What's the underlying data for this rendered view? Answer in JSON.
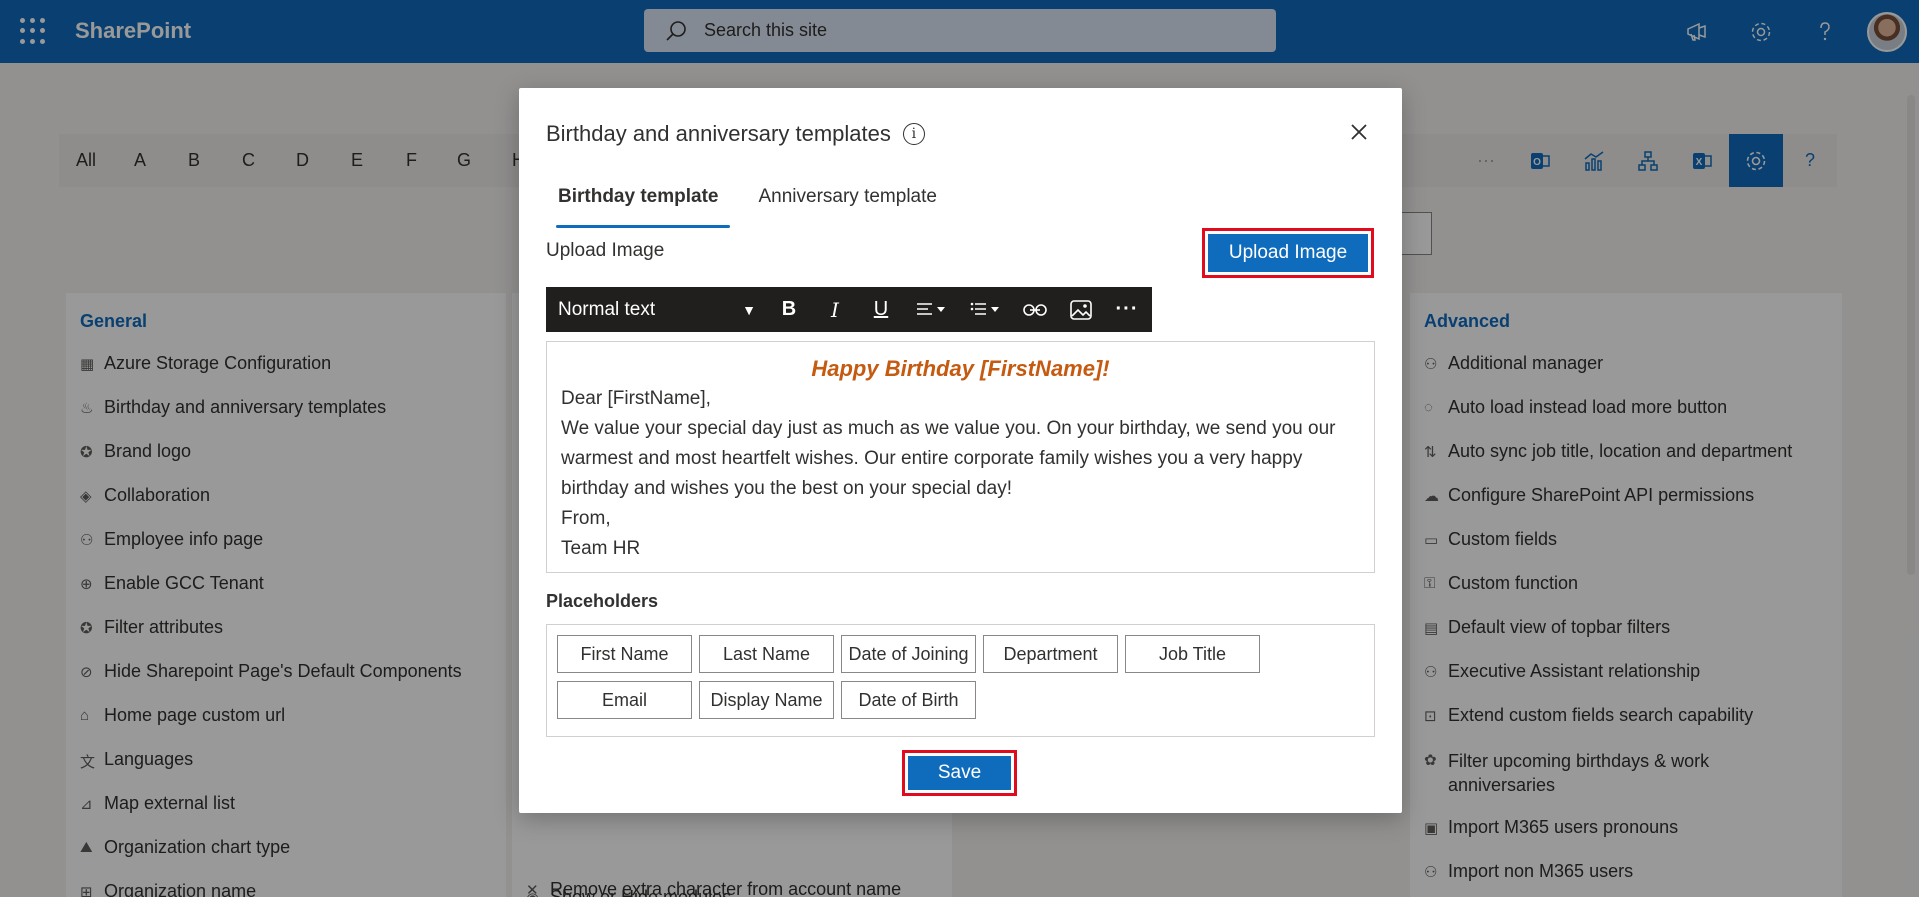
{
  "app": {
    "brand": "SharePoint"
  },
  "search": {
    "placeholder": "Search this site"
  },
  "alphabet": [
    "All",
    "A",
    "B",
    "C",
    "D",
    "E",
    "F",
    "G",
    "H"
  ],
  "general": {
    "heading": "General",
    "items": [
      "Azure Storage Configuration",
      "Birthday and anniversary templates",
      "Brand logo",
      "Collaboration",
      "Employee info page",
      "Enable GCC Tenant",
      "Filter attributes",
      "Hide Sharepoint Page's Default Components",
      "Home page custom url",
      "Languages",
      "Map external list",
      "Organization chart type",
      "Organization name"
    ]
  },
  "middle": {
    "items": [
      "Remove extra character from account name",
      "Show or Hide modules"
    ]
  },
  "advanced": {
    "heading": "Advanced",
    "items": [
      "Additional manager",
      "Auto load instead load more button",
      "Auto sync job title, location and department",
      "Configure SharePoint API permissions",
      "Custom fields",
      "Custom function",
      "Default view of topbar filters",
      "Executive Assistant relationship",
      "Extend custom fields search capability",
      "Filter upcoming birthdays & work anniversaries",
      "Import M365 users pronouns",
      "Import non M365 users"
    ]
  },
  "dialog": {
    "title": "Birthday and anniversary templates",
    "tabs": [
      "Birthday template",
      "Anniversary template"
    ],
    "upload_label": "Upload Image",
    "upload_button": "Upload Image",
    "toolbar": {
      "style": "Normal text"
    },
    "editor": {
      "heading": "Happy Birthday [FirstName]!",
      "salutation": "Dear [FirstName],",
      "body": "We value your special day just as much as we value you. On your birthday, we send you our warmest and most heartfelt wishes. Our entire corporate family wishes you a very happy birthday and wishes you the best on your special day!",
      "closing": "From,",
      "signature": "Team HR"
    },
    "placeholders_title": "Placeholders",
    "placeholders": [
      "First Name",
      "Last Name",
      "Date of Joining",
      "Department",
      "Job Title",
      "Email",
      "Display Name",
      "Date of Birth"
    ],
    "save_button": "Save"
  },
  "colors": {
    "brand": "#0f6cbd",
    "highlight": "#e00b1c",
    "heading_accent": "#c55a11"
  }
}
